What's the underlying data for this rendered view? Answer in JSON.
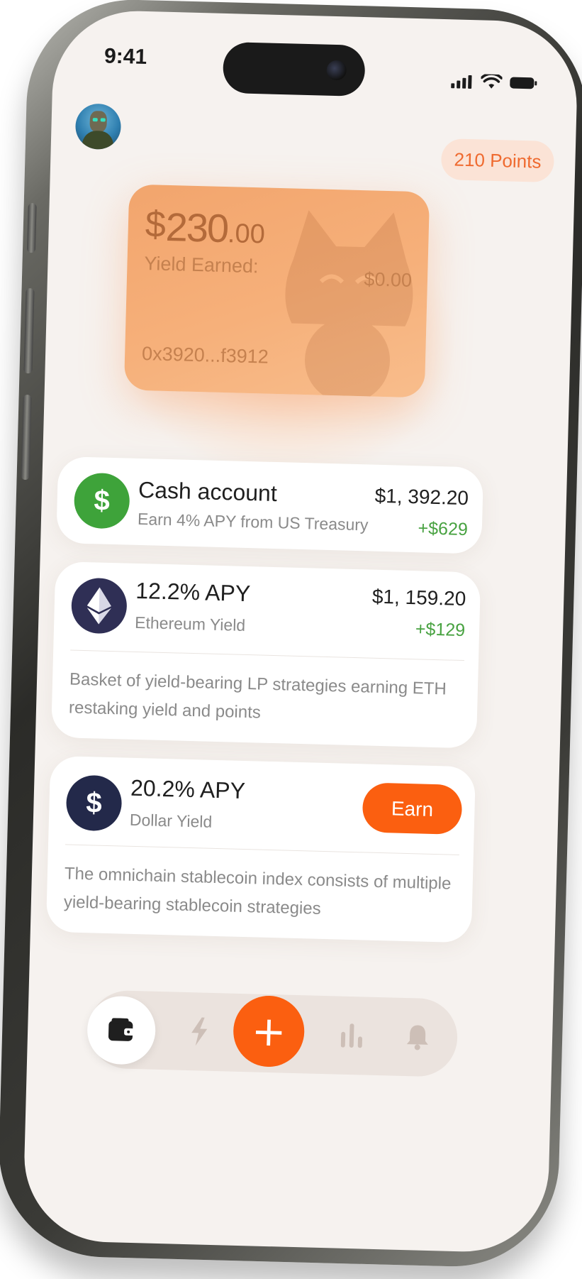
{
  "status_bar": {
    "time": "9:41"
  },
  "header": {
    "points_label": "210 Points"
  },
  "card": {
    "currency_symbol": "$",
    "balance_int": "230",
    "balance_dec": ".00",
    "yield_label": "Yield Earned:",
    "yield_value": "$0.00",
    "address": "0x3920...f3912",
    "color": "#f4a86f"
  },
  "accounts": [
    {
      "icon": "dollar-icon",
      "title": "Cash account",
      "subtitle": "Earn 4% APY from US Treasury",
      "amount": "$1, 392.20",
      "gain": "+$629"
    },
    {
      "icon": "ethereum-icon",
      "title": "12.2% APY",
      "subtitle": "Ethereum Yield",
      "amount": "$1, 159.20",
      "gain": "+$129",
      "description": "Basket of yield-bearing LP strategies earning ETH restaking yield and points"
    },
    {
      "icon": "dollar-icon",
      "title": "20.2% APY",
      "subtitle": "Dollar Yield",
      "button_label": "Earn",
      "description": "The omnichain stablecoin index consists of multiple yield-bearing stablecoin strategies"
    }
  ],
  "tabbar": {
    "items": [
      {
        "icon": "wallet-icon",
        "active": true
      },
      {
        "icon": "lightning-icon"
      },
      {
        "icon": "plus-icon",
        "label": "+"
      },
      {
        "icon": "bar-chart-icon"
      },
      {
        "icon": "bell-icon"
      }
    ]
  },
  "colors": {
    "accent": "#fb5f10",
    "positive": "#48a241",
    "background": "#f6f2ef"
  }
}
